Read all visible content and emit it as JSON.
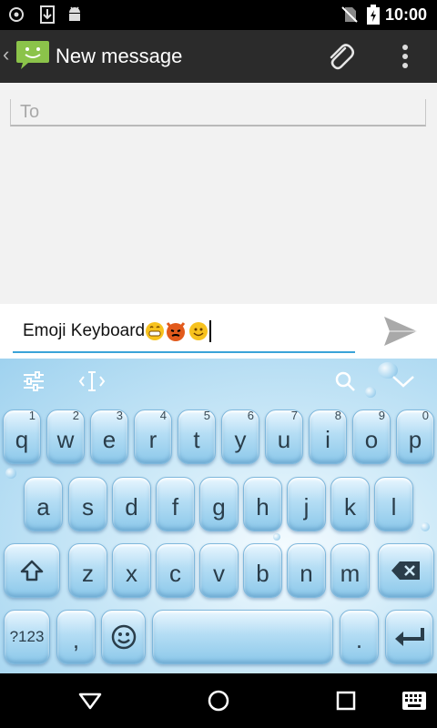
{
  "status_bar": {
    "time": "10:00",
    "icons": [
      "sync-icon",
      "download-icon",
      "android-icon",
      "no-sim-icon",
      "battery-charging-icon"
    ]
  },
  "action_bar": {
    "title": "New message",
    "icons": [
      "back-icon",
      "messaging-app-icon",
      "attach-icon",
      "overflow-menu-icon"
    ]
  },
  "compose": {
    "to_placeholder": "To",
    "message_text": "Emoji Keyboard",
    "message_emojis": [
      "grinning-face-emoji",
      "imp-devil-emoji",
      "smiling-face-emoji"
    ]
  },
  "keyboard": {
    "toolbar_icons": [
      "settings-sliders-icon",
      "cursor-move-icon",
      "search-icon",
      "collapse-icon"
    ],
    "rows": [
      [
        {
          "label": "q",
          "hint": "1"
        },
        {
          "label": "w",
          "hint": "2"
        },
        {
          "label": "e",
          "hint": "3"
        },
        {
          "label": "r",
          "hint": "4"
        },
        {
          "label": "t",
          "hint": "5"
        },
        {
          "label": "y",
          "hint": "6"
        },
        {
          "label": "u",
          "hint": "7"
        },
        {
          "label": "i",
          "hint": "8"
        },
        {
          "label": "o",
          "hint": "9"
        },
        {
          "label": "p",
          "hint": "0"
        }
      ],
      [
        {
          "label": "a"
        },
        {
          "label": "s"
        },
        {
          "label": "d"
        },
        {
          "label": "f"
        },
        {
          "label": "g"
        },
        {
          "label": "h"
        },
        {
          "label": "j"
        },
        {
          "label": "k"
        },
        {
          "label": "l"
        }
      ],
      [
        {
          "label": "z"
        },
        {
          "label": "x"
        },
        {
          "label": "c"
        },
        {
          "label": "v"
        },
        {
          "label": "b"
        },
        {
          "label": "n"
        },
        {
          "label": "m"
        }
      ]
    ],
    "bottom": {
      "symbols_label": "?123",
      "comma_label": ",",
      "period_label": "."
    }
  },
  "colors": {
    "accent": "#3aa3d8",
    "action_bar": "#2b2b2b",
    "key_text": "#2a3d4a"
  }
}
